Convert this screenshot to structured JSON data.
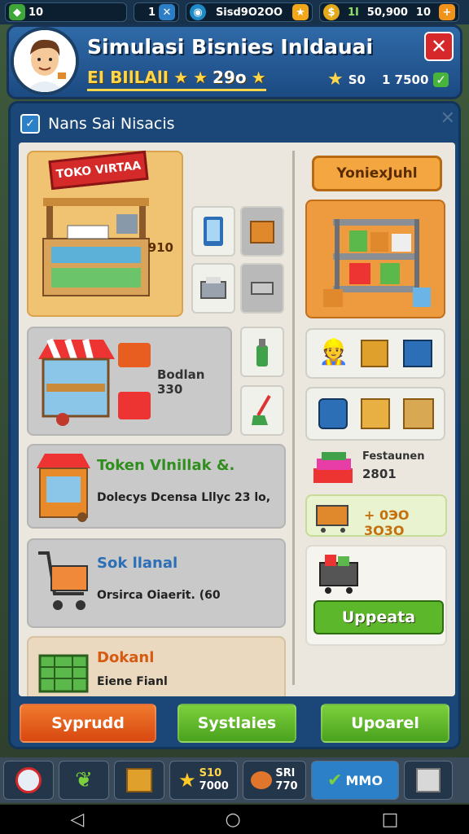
{
  "topbar": {
    "res1_value": "10",
    "res2_value": "1",
    "res3_value": "Sisd9O2OO",
    "res4_value": "1I",
    "res5_value": "50,900",
    "res6_value": "10"
  },
  "header": {
    "title": "Simulasi Bisnies Inldauai",
    "subtitle": "EI BIlLAlI",
    "subtitle_value": "29o",
    "stat1": "S0",
    "stat2": "1 7500"
  },
  "panel": {
    "heading": "Nans Sai Nisacis"
  },
  "left": {
    "shop_sign": "TOKO VIRTAA",
    "shop_value": "910",
    "stall_label": "Bodlan 330",
    "row1_title": "Token Vlnillak &.",
    "row1_sub": "Dolecys Dcensa Lllyc 23 lo,",
    "row2_title": "Sok llanal",
    "row2_sub": "Orsirca Oiaerit. (60",
    "row3_title": "Dokanl",
    "row3_sub": "Eiene Fianl"
  },
  "right": {
    "badge": "YoniexJuhl",
    "promo_title": "Festaunen",
    "promo_value": "2801",
    "price_text": "+ 0ЭО 3О3О",
    "upgrade_button": "Uppeata"
  },
  "buttons": {
    "left": "Syprudd",
    "mid": "Systlaies",
    "right": "Upoarel"
  },
  "tabbar": {
    "tab4_value_top": "S10",
    "tab4_value_bottom": "7000",
    "tab5_value_top": "SRl",
    "tab5_value_bottom": "770",
    "tab6_value": "MMO"
  },
  "colors": {
    "orange_button": "#ee5a1f",
    "green_button": "#5cb82a",
    "accent_blue": "#1a4777",
    "close_red": "#d6282b"
  }
}
